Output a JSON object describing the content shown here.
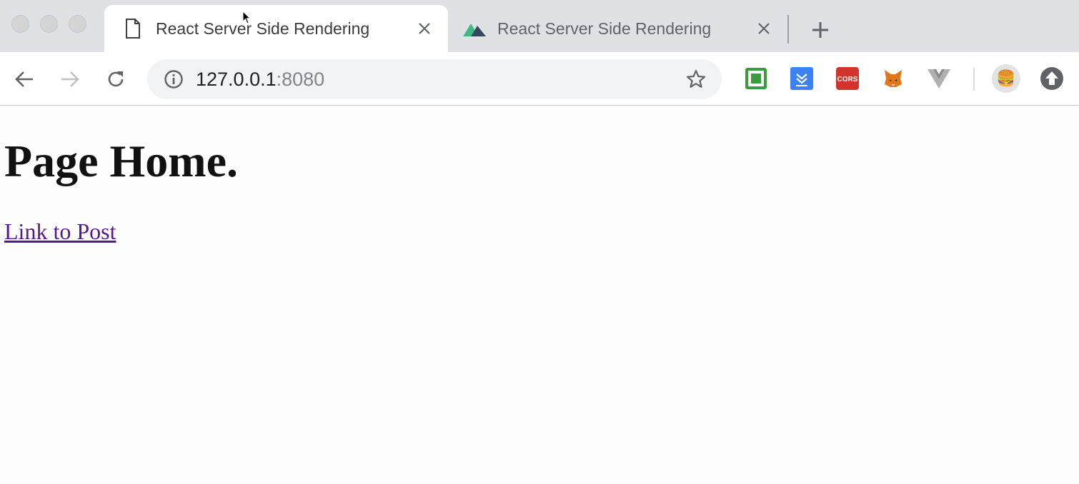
{
  "tabs": [
    {
      "title": "React Server Side Rendering",
      "favicon": "document-icon",
      "active": true
    },
    {
      "title": "React Server Side Rendering",
      "favicon": "nuxt-mountain-icon",
      "active": false
    }
  ],
  "toolbar": {
    "url_host": "127.0.0.1",
    "url_port": ":8080",
    "extensions": [
      "green-square-extension-icon",
      "pocket-download-extension-icon",
      "cors-extension-icon",
      "metamask-fox-extension-icon",
      "vue-devtools-extension-icon"
    ],
    "cors_label": "CORS",
    "avatar": "🍔"
  },
  "page": {
    "heading": "Page Home.",
    "link_text": "Link to Post"
  },
  "colors": {
    "link": "#551a8b",
    "tab_strip": "#dfe1e5",
    "omnibox": "#f1f3f4"
  }
}
